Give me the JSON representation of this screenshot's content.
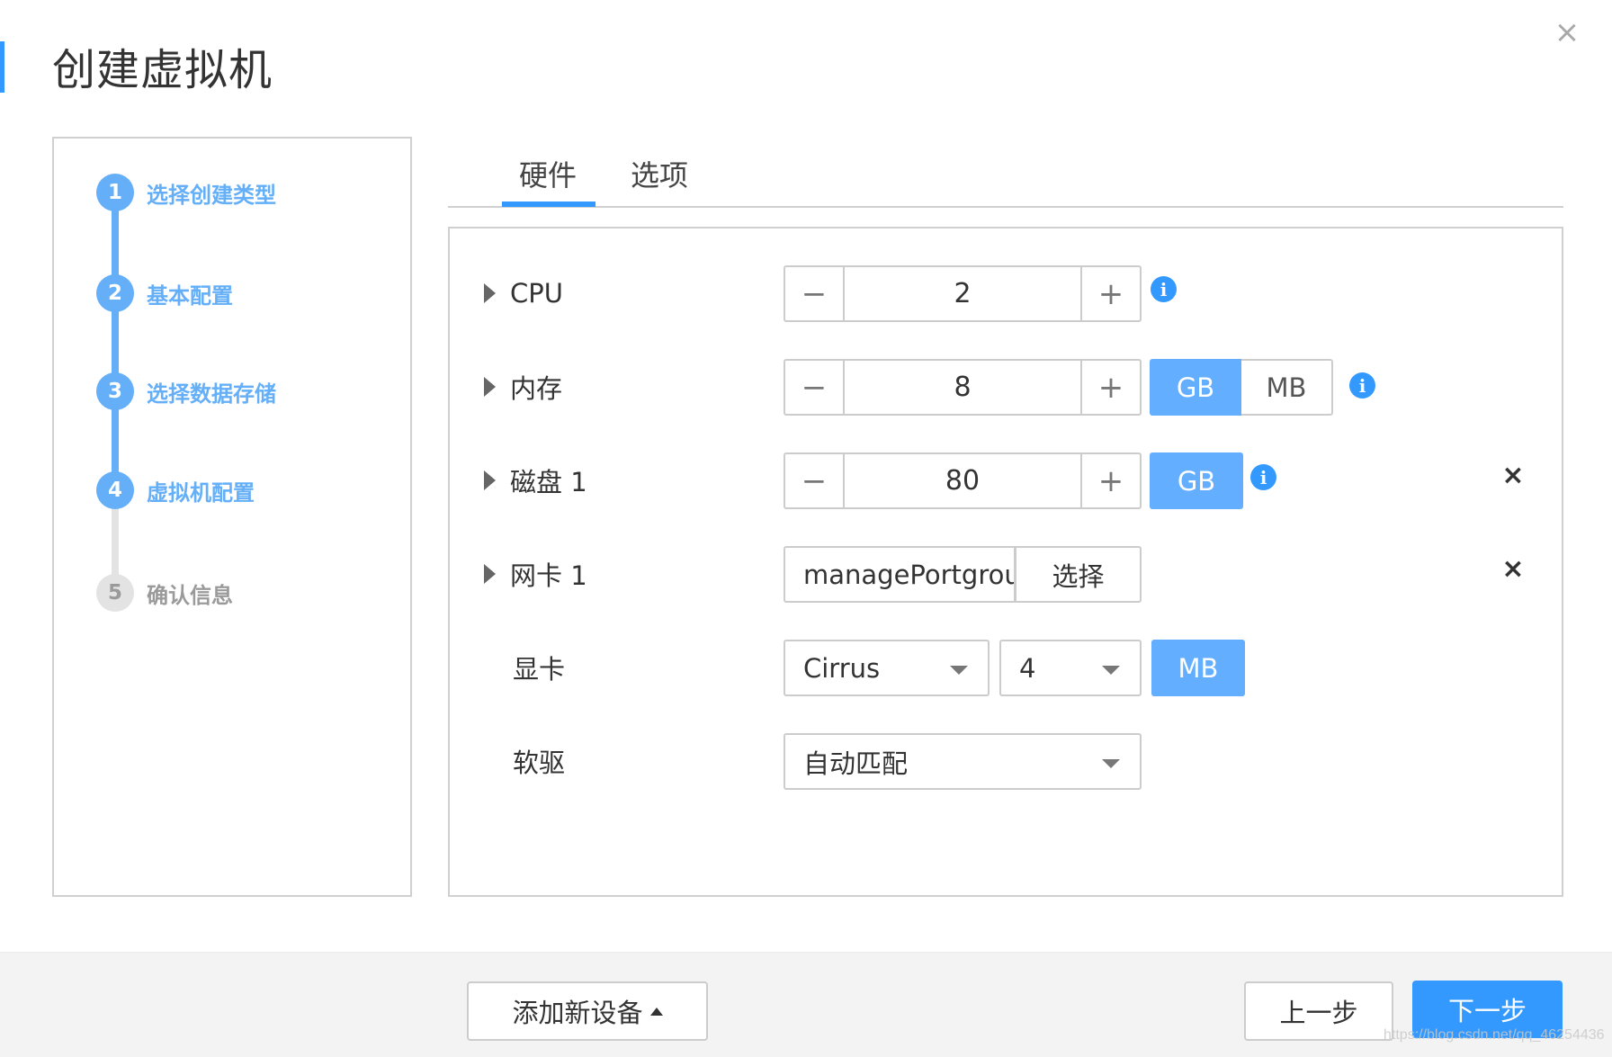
{
  "dialog": {
    "title": "创建虚拟机",
    "close_icon": "×"
  },
  "steps": [
    {
      "num": "1",
      "label": "选择创建类型",
      "state": "done"
    },
    {
      "num": "2",
      "label": "基本配置",
      "state": "done"
    },
    {
      "num": "3",
      "label": "选择数据存储",
      "state": "done"
    },
    {
      "num": "4",
      "label": "虚拟机配置",
      "state": "current"
    },
    {
      "num": "5",
      "label": "确认信息",
      "state": "pending"
    }
  ],
  "tabs": [
    {
      "label": "硬件",
      "active": true
    },
    {
      "label": "选项",
      "active": false
    }
  ],
  "hardware": {
    "cpu": {
      "label": "CPU",
      "value": "2",
      "minus": "−",
      "plus": "+"
    },
    "memory": {
      "label": "内存",
      "value": "8",
      "minus": "−",
      "plus": "+",
      "units": [
        "GB",
        "MB"
      ],
      "selected_unit": "GB"
    },
    "disk": {
      "label": "磁盘 1",
      "value": "80",
      "minus": "−",
      "plus": "+",
      "unit": "GB"
    },
    "nic": {
      "label": "网卡 1",
      "value": "managePortgroup",
      "select_label": "选择"
    },
    "gpu": {
      "label": "显卡",
      "model": "Cirrus",
      "memory": "4",
      "unit": "MB"
    },
    "floppy": {
      "label": "软驱",
      "value": "自动匹配"
    },
    "info_icon": "i",
    "delete_icon": "×"
  },
  "footer": {
    "add_device": "添加新设备",
    "prev": "上一步",
    "next": "下一步"
  },
  "watermark": "https://blog.csdn.net/qq_46254436",
  "colors": {
    "accent": "#3399ff",
    "step_active": "#64aff8",
    "step_inactive": "#e3e3e3",
    "unit_selected": "#64aeff"
  }
}
